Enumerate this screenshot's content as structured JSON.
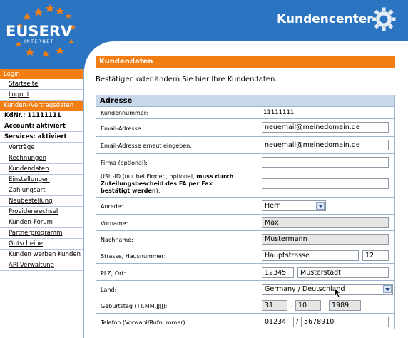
{
  "header": {
    "logo_text": "EUSERV",
    "logo_sub": "INTERNET",
    "brand": "Kundencenter",
    "colors": {
      "header_bg": "#2a74c2",
      "accent": "#f27d13",
      "section_bg": "#c8d8ea"
    }
  },
  "sidebar": {
    "login_title": "Login",
    "login_links": [
      "Startseite",
      "Logout"
    ],
    "contract_title": "Kunden-/Vertragsdaten",
    "kdnr": "KdNr.: 11111111",
    "account": "Account: aktiviert",
    "services": "Services: aktiviert",
    "links": [
      "Verträge",
      "Rechnungen",
      "Kundendaten",
      "Einstellungen",
      "Zahlungsart",
      "Neubestellung",
      "Providerwechsel",
      "Kunden-Forum",
      "Partnerprogramm",
      "Gutscheine",
      "Kunden werben Kunden",
      "API-Verwaltung"
    ]
  },
  "main": {
    "title": "Kundendaten",
    "intro": "Bestätigen oder ändern Sie hier Ihre Kundendaten.",
    "section_title": "Adresse",
    "labels": {
      "kundennummer": "Kundennummer:",
      "email": "Email-Adresse:",
      "email2": "Email-Adresse erneut eingeben:",
      "firma": "Firma (optional):",
      "ust_pre": "USt.-ID (nur bei Firmen, optional,",
      "ust_bold": "muss durch Zuteilungsbescheid des FA per Fax bestätigt werden",
      "ust_post": "):",
      "anrede": "Anrede:",
      "vorname": "Vorname:",
      "nachname": "Nachname:",
      "strasse": "Strasse, Hausnummer:",
      "plz": "PLZ, Ort:",
      "land": "Land:",
      "geburtstag": "Geburtstag (TT.MM.JJJJ):",
      "telefon": "Telefon (Vorwahl/Rufnummer):"
    },
    "values": {
      "kundennummer": "11111111",
      "email": "neuemail@meinedomain.de",
      "email2": "neuemail@meinedomain.de",
      "firma": "",
      "ust": "",
      "anrede": "Herr",
      "vorname": "Max",
      "nachname": "Mustermann",
      "strasse": "Hauptstrasse",
      "hausnummer": "12",
      "plz": "12345",
      "ort": "Musterstadt",
      "land": "Germany / Deutschland",
      "tag": "31",
      "monat": "10",
      "jahr": "1989",
      "vorwahl": "01234",
      "rufnummer": "5678910",
      "dot": ".",
      "slash": "/"
    }
  }
}
